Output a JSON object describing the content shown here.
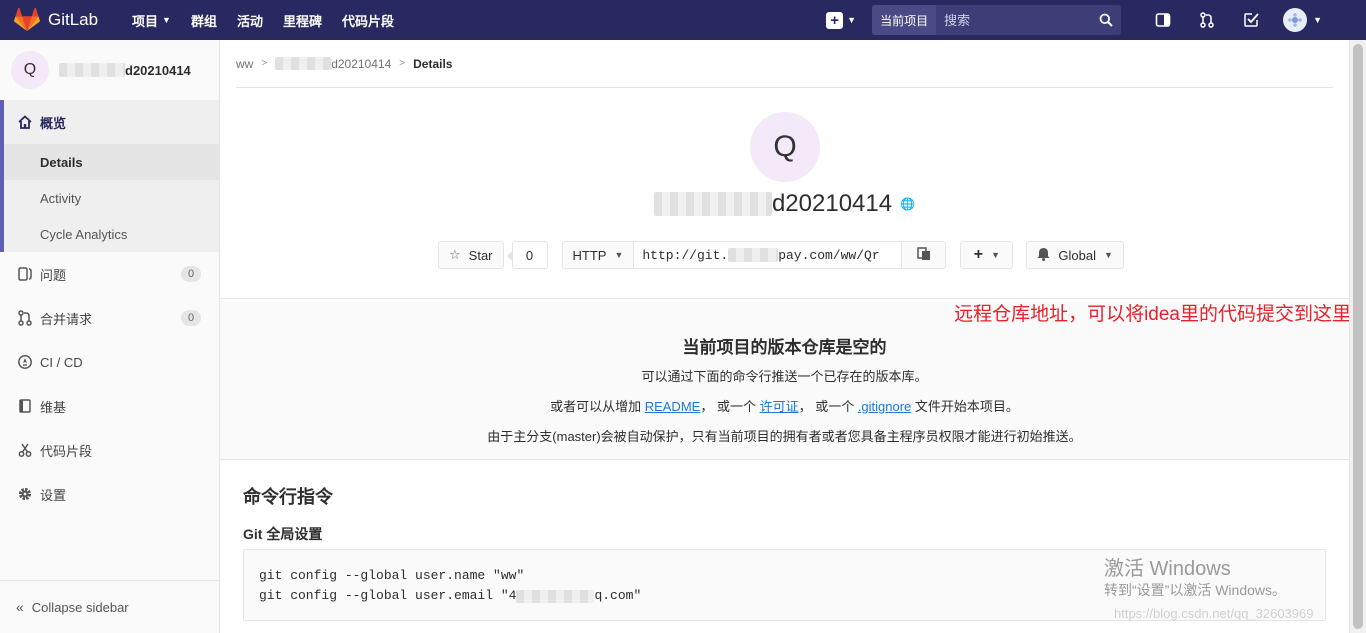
{
  "navbar": {
    "brand": "GitLab",
    "links": [
      {
        "label": "项目",
        "dropdown": true
      },
      {
        "label": "群组",
        "dropdown": false
      },
      {
        "label": "活动",
        "dropdown": false
      },
      {
        "label": "里程碑",
        "dropdown": false
      },
      {
        "label": "代码片段",
        "dropdown": false
      }
    ],
    "search_scope": "当前项目",
    "search_placeholder": "搜索"
  },
  "sidebar": {
    "project_initial": "Q",
    "project_name_visible": "d20210414",
    "overview": "概览",
    "overview_items": [
      "Details",
      "Activity",
      "Cycle Analytics"
    ],
    "items": [
      {
        "label": "问题",
        "count": "0",
        "icon": "issues-icon"
      },
      {
        "label": "合并请求",
        "count": "0",
        "icon": "merge-request-icon"
      },
      {
        "label": "CI / CD",
        "count": null,
        "icon": "rocket-icon"
      },
      {
        "label": "维基",
        "count": null,
        "icon": "book-icon"
      },
      {
        "label": "代码片段",
        "count": null,
        "icon": "scissors-icon"
      },
      {
        "label": "设置",
        "count": null,
        "icon": "gear-icon"
      }
    ],
    "collapse": "Collapse sidebar"
  },
  "breadcrumb": {
    "root": "ww",
    "project_visible": "d20210414",
    "current": "Details"
  },
  "project": {
    "initial": "Q",
    "title_visible": "d20210414",
    "star_label": "Star",
    "star_count": "0",
    "clone_protocol": "HTTP",
    "clone_url_start": "http://git.",
    "clone_url_end": "pay.com/ww/Qr",
    "notification": "Global"
  },
  "annotation": "远程仓库地址，可以将idea里的代码提交到这里",
  "empty_repo": {
    "title": "当前项目的版本仓库是空的",
    "line1": "可以通过下面的命令行推送一个已存在的版本库。",
    "line2_prefix": "或者可以从增加 ",
    "readme": "README",
    "line2_mid1": "， 或一个 ",
    "license": "许可证",
    "line2_mid2": "， 或一个 ",
    "gitignore": ".gitignore",
    "line2_suffix": " 文件开始本项目。",
    "line3": "由于主分支(master)会被自动保护，只有当前项目的拥有者或者您具备主程序员权限才能进行初始推送。"
  },
  "commands": {
    "title": "命令行指令",
    "global_title": "Git 全局设置",
    "line1": "git config --global user.name \"ww\"",
    "line2_start": "git config --global user.email \"4",
    "line2_end": "q.com\""
  },
  "watermark": {
    "windows": "激活 Windows",
    "windows_sub": "转到“设置”以激活 Windows。",
    "url": "https://blog.csdn.net/qq_32603969"
  }
}
